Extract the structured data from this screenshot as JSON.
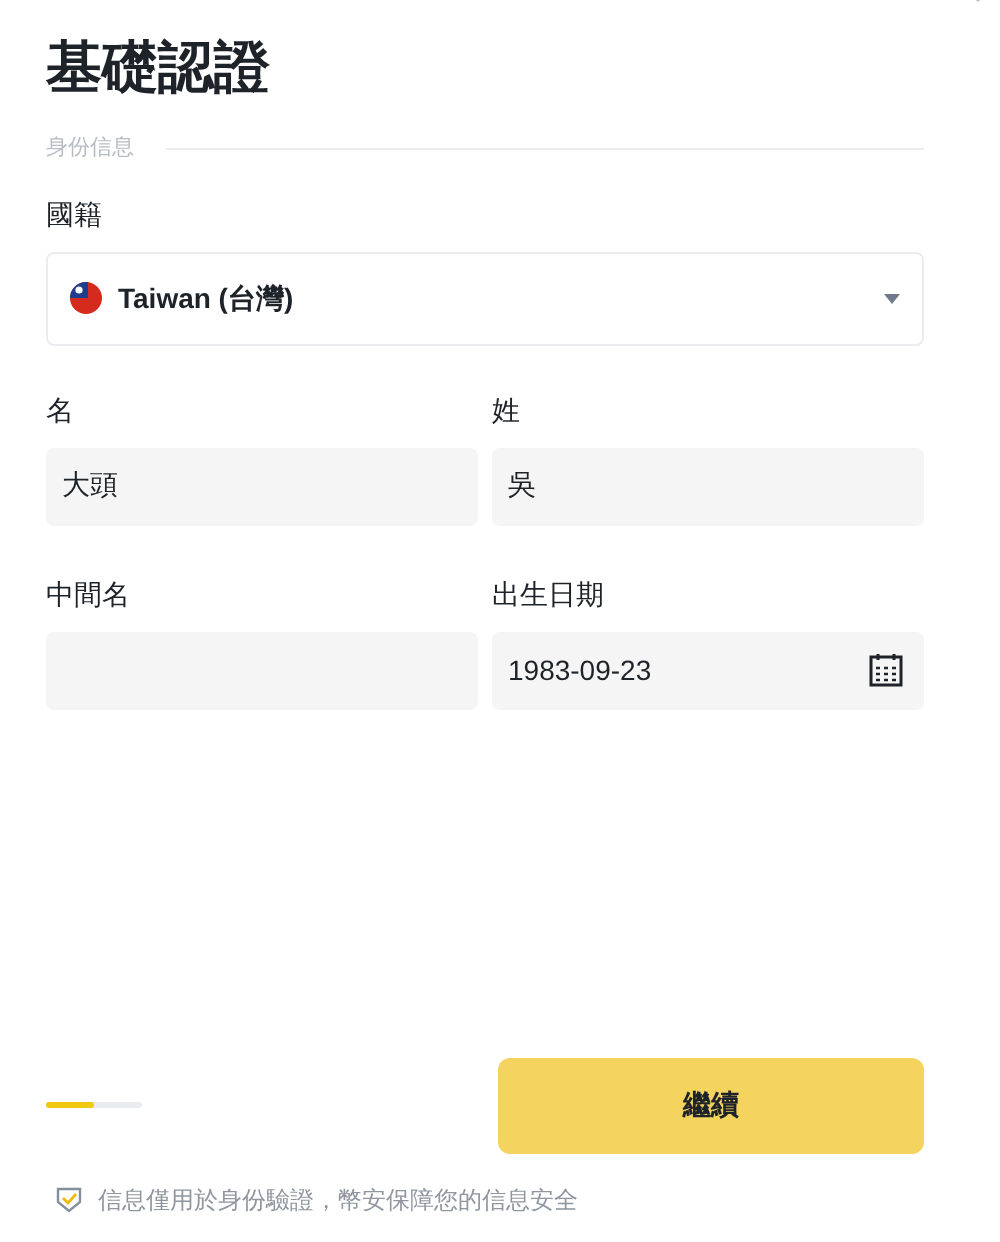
{
  "title": "基礎認證",
  "section": "身份信息",
  "nationality": {
    "label": "國籍",
    "value": "Taiwan (台灣)"
  },
  "fields": [
    {
      "label": "名",
      "value": "大頭",
      "kind": "text"
    },
    {
      "label": "姓",
      "value": "吳",
      "kind": "text"
    },
    {
      "label": "中間名",
      "kind": "text"
    },
    {
      "label": "出生日期",
      "value": "1983-09-23",
      "kind": "date"
    }
  ],
  "progress": {
    "level": 0.5
  },
  "button": "繼續",
  "notice": "信息僅用於身份驗證，幣安保障您的信息安全"
}
